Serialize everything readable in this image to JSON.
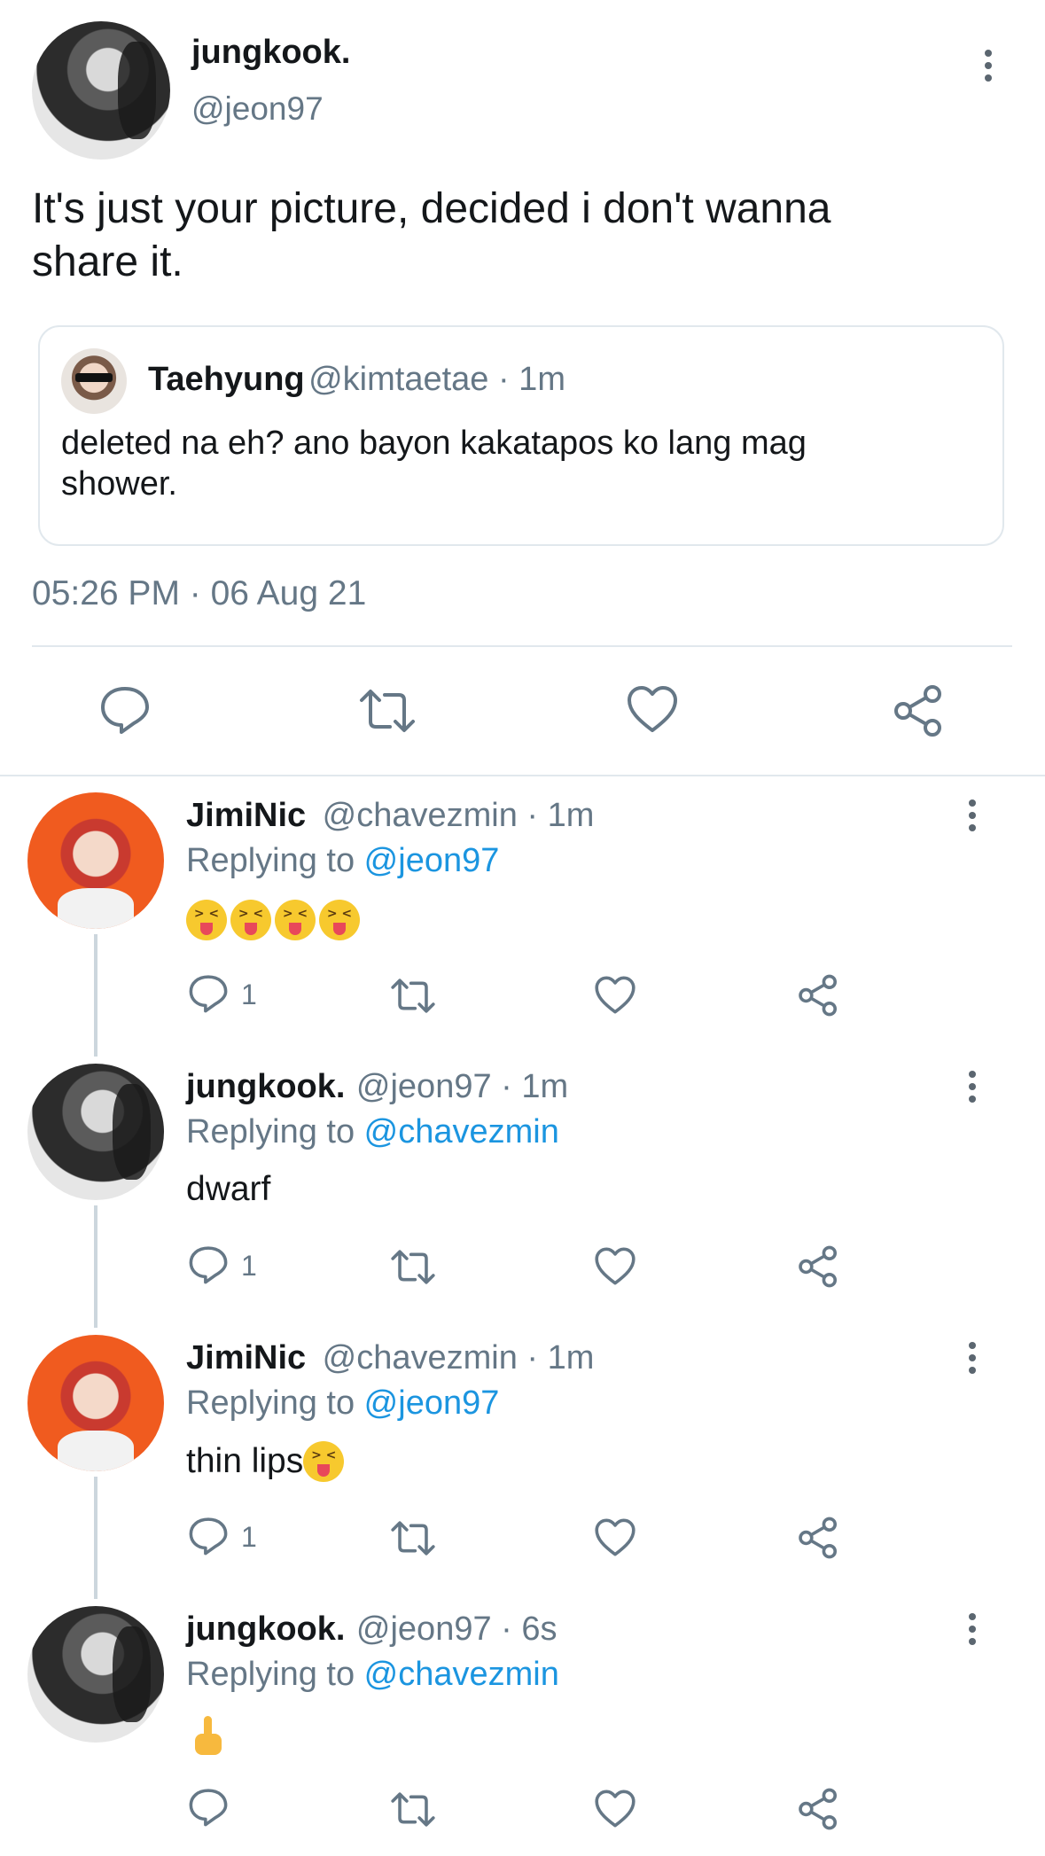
{
  "main_tweet": {
    "author_name": "jungkook.",
    "author_handle": "@jeon97",
    "text_line1": "It's just your picture, decided i don't wanna",
    "text_line2": "share it.",
    "quote": {
      "name": "Taehyung",
      "meta": "@kimtaetae · 1m",
      "text_line1": "deleted na eh? ano bayon kakatapos ko lang mag",
      "text_line2": "shower."
    },
    "timestamp": "05:26 PM · 06 Aug 21",
    "actions": [
      "reply-icon",
      "retweet-icon",
      "like-icon",
      "share-icon"
    ]
  },
  "replies": [
    {
      "name": "JimiNic",
      "meta": "@chavezmin · 1m",
      "replying_prefix": "Replying to ",
      "replying_to": "@jeon97",
      "text": "",
      "emoji": [
        "squinting-face-with-tongue",
        "squinting-face-with-tongue",
        "squinting-face-with-tongue",
        "squinting-face-with-tongue"
      ],
      "reply_count": "1"
    },
    {
      "name": "jungkook.",
      "meta": "@jeon97 · 1m",
      "replying_prefix": "Replying to ",
      "replying_to": "@chavezmin",
      "text": "dwarf",
      "reply_count": "1"
    },
    {
      "name": "JimiNic",
      "meta": "@chavezmin · 1m",
      "replying_prefix": "Replying to ",
      "replying_to": "@jeon97",
      "text": "thin lips",
      "emoji": [
        "squinting-face-with-tongue"
      ],
      "reply_count": "1"
    },
    {
      "name": "jungkook.",
      "meta": "@jeon97 · 6s",
      "replying_prefix": "Replying to ",
      "replying_to": "@chavezmin",
      "text": "",
      "emoji": [
        "backhand-index-pointing-up"
      ],
      "reply_count": ""
    }
  ],
  "colors": {
    "link": "#1b95e0",
    "muted": "#657786",
    "border": "#e1e8ed",
    "thread_line": "#ccd6dd"
  }
}
